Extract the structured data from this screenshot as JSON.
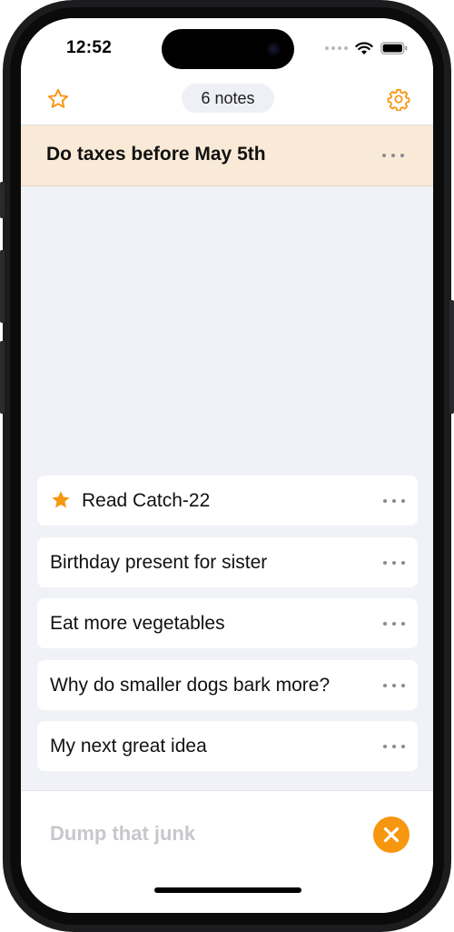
{
  "status_bar": {
    "time": "12:52"
  },
  "header": {
    "notes_count": "6 notes"
  },
  "pinned_note": {
    "text": "Do taxes before May 5th"
  },
  "notes": [
    {
      "text": "Read Catch-22",
      "starred": true
    },
    {
      "text": "Birthday present for sister",
      "starred": false
    },
    {
      "text": "Eat more vegetables",
      "starred": false
    },
    {
      "text": "Why do smaller dogs bark more?",
      "starred": false
    },
    {
      "text": "My next great idea",
      "starred": false
    }
  ],
  "composer": {
    "placeholder": "Dump that junk"
  },
  "colors": {
    "accent": "#f7960f",
    "pinned_bg": "#f8ead6",
    "list_bg": "#f1f2f7"
  },
  "icons": {
    "favorites": "star-outline-icon",
    "settings": "gear-icon",
    "note_menu": "ellipsis-icon",
    "clear": "close-circle-icon",
    "star": "star-filled-icon"
  }
}
